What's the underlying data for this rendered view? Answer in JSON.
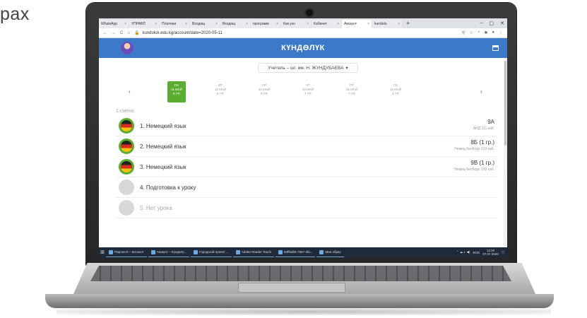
{
  "corner_text": "рах",
  "browser": {
    "tabs": [
      {
        "label": "WhatsApp",
        "active": false
      },
      {
        "label": "УПРАВЛ",
        "active": false
      },
      {
        "label": "Платежи",
        "active": false
      },
      {
        "label": "Входящ",
        "active": false
      },
      {
        "label": "Входящ",
        "active": false
      },
      {
        "label": "программ",
        "active": false
      },
      {
        "label": "Как узн",
        "active": false
      },
      {
        "label": "Кабинет",
        "active": false
      },
      {
        "label": "Аккаунт",
        "active": true
      },
      {
        "label": "kundelu",
        "active": false
      }
    ],
    "new_tab": "+",
    "url": "kundoluk.edu.kg/account/date=2020-05-11",
    "window_controls": {
      "minimize": "–",
      "maximize": "▢",
      "close": "✕"
    }
  },
  "app": {
    "logo": "КҮНДӨЛҮК",
    "teacher_select": "Учитель – шг. им. Н. ЖУНДУБАЕВА",
    "days": [
      {
        "dow": "ПН",
        "date": "11 МАЙ",
        "count": "6 УР.",
        "active": true
      },
      {
        "dow": "ВТ",
        "date": "12 МАЙ",
        "count": "6 УР.",
        "active": false
      },
      {
        "dow": "СР",
        "date": "13 МАЙ",
        "count": "3 УР.",
        "active": false
      },
      {
        "dow": "ЧТ",
        "date": "14 МАЙ",
        "count": "7 УР.",
        "active": false
      },
      {
        "dow": "ПТ",
        "date": "15 МАЙ",
        "count": "7 УР.",
        "active": false
      },
      {
        "dow": "СБ",
        "date": "16 МАЙ",
        "count": "4 УР.",
        "active": false
      }
    ],
    "section": "1 смена",
    "lessons": [
      {
        "title": "1. Немецкий язык",
        "class": "9А",
        "room": "АНД 111 каб.",
        "icon": "flag",
        "muted": false
      },
      {
        "title": "2. Немецкий язык",
        "class": "8Б (1 гр.)",
        "room": "Немец бөлбору 103 каб.",
        "icon": "flag",
        "muted": false
      },
      {
        "title": "3. Немецкий язык",
        "class": "9В (1 гр.)",
        "room": "Немец бөлбору 103 каб.",
        "icon": "flag",
        "muted": false
      },
      {
        "title": "4. Подготовка к уроку",
        "class": "",
        "room": "",
        "icon": "empty",
        "muted": false
      },
      {
        "title": "5. Нет урока",
        "class": "",
        "room": "",
        "icon": "empty",
        "muted": true
      }
    ]
  },
  "taskbar": {
    "items": [
      "Пароли К – Блокнот",
      "Аккаунт – Күндөлү...",
      "Городской проект ...",
      "Adobe Reader Touch",
      "53ff5db5-7667-4fa...",
      "Мин образ"
    ],
    "lang": "ENG",
    "time": "12:20",
    "date": "07.07.2020"
  }
}
